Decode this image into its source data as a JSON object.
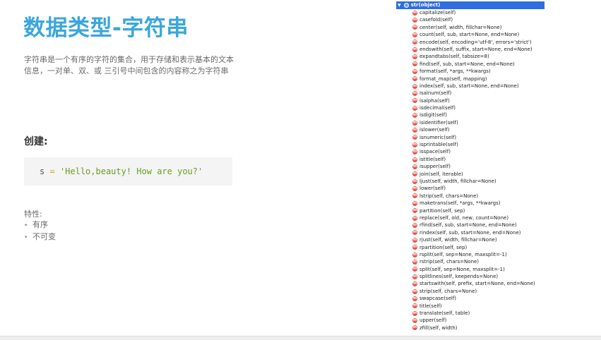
{
  "slide": {
    "title": "数据类型-字符串",
    "description": "字符串是一个有序的字符的集合，用于存储和表示基本的文本信息，一对单、双、或 三引号中间包含的内容称之为字符串",
    "create_heading": "创建:",
    "code": {
      "variable": "s",
      "operator": "=",
      "string": "'Hello,beauty! How are you?'"
    },
    "features_label": "特性:",
    "features": [
      "有序",
      "不可变"
    ]
  },
  "structure": {
    "class_label": "str(object)",
    "method_icon_letter": "m",
    "methods": [
      "capitalize(self)",
      "casefold(self)",
      "center(self, width, fillchar=None)",
      "count(self, sub, start=None, end=None)",
      "encode(self, encoding='utf-8', errors='strict')",
      "endswith(self, suffix, start=None, end=None)",
      "expandtabs(self, tabsize=8)",
      "find(self, sub, start=None, end=None)",
      "format(self, *args, **kwargs)",
      "format_map(self, mapping)",
      "index(self, sub, start=None, end=None)",
      "isalnum(self)",
      "isalpha(self)",
      "isdecimal(self)",
      "isdigit(self)",
      "isidentifier(self)",
      "islower(self)",
      "isnumeric(self)",
      "isprintable(self)",
      "isspace(self)",
      "istitle(self)",
      "isupper(self)",
      "join(self, iterable)",
      "ljust(self, width, fillchar=None)",
      "lower(self)",
      "lstrip(self, chars=None)",
      "maketrans(self, *args, **kwargs)",
      "partition(self, sep)",
      "replace(self, old, new, count=None)",
      "rfind(self, sub, start=None, end=None)",
      "rindex(self, sub, start=None, end=None)",
      "rjust(self, width, fillchar=None)",
      "rpartition(self, sep)",
      "rsplit(self, sep=None, maxsplit=-1)",
      "rstrip(self, chars=None)",
      "split(self, sep=None, maxsplit=-1)",
      "splitlines(self, keepends=None)",
      "startswith(self, prefix, start=None, end=None)",
      "strip(self, chars=None)",
      "swapcase(self)",
      "title(self)",
      "translate(self, table)",
      "upper(self)",
      "zfill(self, width)"
    ]
  }
}
